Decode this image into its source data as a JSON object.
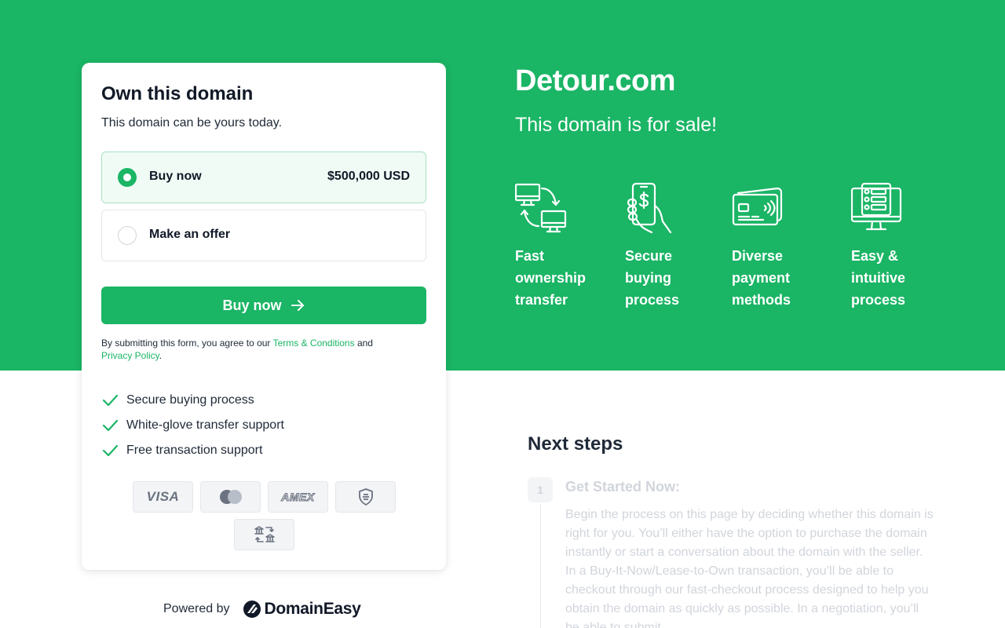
{
  "hero": {
    "domain": "Detour.com",
    "tagline": "This domain is for sale!",
    "features": [
      {
        "label": "Fast ownership transfer",
        "icon": "transfer-computers-icon"
      },
      {
        "label": "Secure buying process",
        "icon": "phone-payment-icon"
      },
      {
        "label": "Diverse payment methods",
        "icon": "credit-card-icon"
      },
      {
        "label": "Easy & intuitive process",
        "icon": "monitor-checklist-icon"
      }
    ]
  },
  "card": {
    "title": "Own this domain",
    "subtitle": "This domain can be yours today.",
    "options": [
      {
        "label": "Buy now",
        "price": "$500,000 USD",
        "selected": true
      },
      {
        "label": "Make an offer",
        "price": "",
        "selected": false
      }
    ],
    "button_label": "Buy now",
    "legal": {
      "prefix": "By submitting this form, you agree to our ",
      "terms": "Terms & Conditions",
      "middle": " and ",
      "privacy": "Privacy Policy",
      "suffix": "."
    },
    "benefits": [
      "Secure buying process",
      "White-glove transfer support",
      "Free transaction support"
    ],
    "payments": {
      "visa": "VISA",
      "amex": "AMEX"
    }
  },
  "footer": {
    "powered_by": "Powered by",
    "brand": "DomainEasy"
  },
  "next_steps": {
    "title": "Next steps",
    "steps": [
      {
        "number": "1",
        "title": "Get Started Now:",
        "body": "Begin the process on this page by deciding whether this domain is right for you. You’ll either have the option to purchase the domain instantly or start a conversation about the domain with the seller. In a Buy-It-Now/Lease-to-Own transaction, you’ll be able to checkout through our fast-checkout process designed to help you obtain the domain as quickly as possible. In a negotiation, you’ll be able to submit"
      }
    ]
  },
  "colors": {
    "brand_green": "#1ab565",
    "text_dark": "#111827",
    "muted": "#d1d5db"
  }
}
